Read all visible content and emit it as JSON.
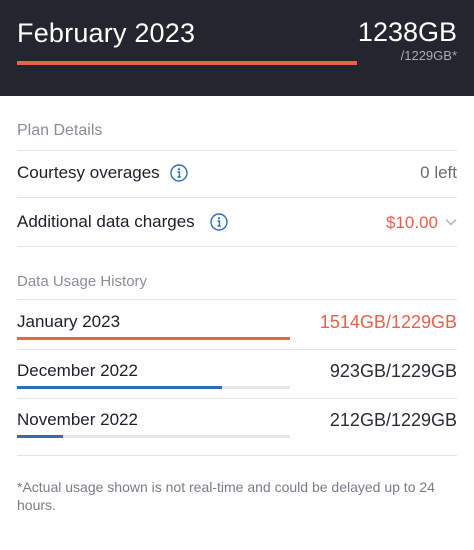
{
  "header": {
    "month": "February 2023",
    "used": "1238GB",
    "limit": "/1229GB*",
    "usage_fraction": 1.0,
    "bar_color": "#e8614d"
  },
  "plan": {
    "section_label": "Plan Details",
    "courtesy": {
      "label": "Courtesy overages",
      "icon": "info-icon",
      "value": "0 left"
    },
    "additional": {
      "label": "Additional data charges",
      "icon": "info-icon",
      "value": "$10.00",
      "chevron": "chevron-down-icon"
    }
  },
  "history": {
    "section_label": "Data Usage History",
    "items": [
      {
        "month": "January 2023",
        "usage": "1514GB/1229GB",
        "fraction": 1.0,
        "color": "#e8614d",
        "over": true
      },
      {
        "month": "December 2022",
        "usage": "923GB/1229GB",
        "fraction": 0.75,
        "color": "#2f6fb0",
        "over": false
      },
      {
        "month": "November 2022",
        "usage": "212GB/1229GB",
        "fraction": 0.17,
        "color": "#2f6fb0",
        "over": false
      }
    ]
  },
  "footnote": "*Actual usage shown is not real-time and could be delayed up to 24 hours."
}
